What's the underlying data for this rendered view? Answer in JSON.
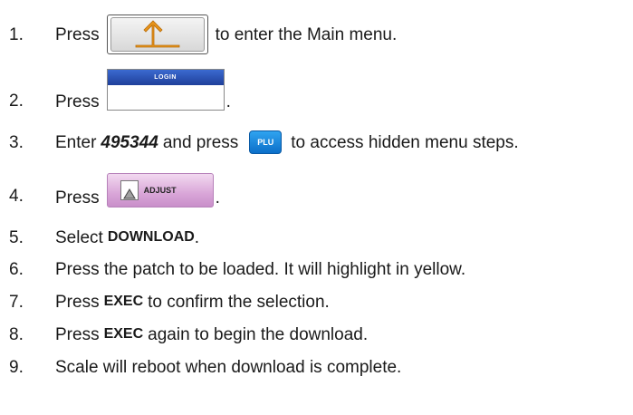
{
  "steps": [
    {
      "num": "1.",
      "pre": "Press",
      "post": "to enter the Main menu."
    },
    {
      "num": "2.",
      "pre": "Press",
      "post": "."
    },
    {
      "num": "3.",
      "pre": "Enter",
      "code": "495344",
      "mid": "and press",
      "post": "to access hidden menu steps."
    },
    {
      "num": "4.",
      "pre": "Press",
      "post": "."
    },
    {
      "num": "5.",
      "pre": "Select",
      "bold": "DOWNLOAD",
      "post": "."
    },
    {
      "num": "6.",
      "text": "Press the patch to be loaded. It will highlight in yellow."
    },
    {
      "num": "7.",
      "pre": "Press",
      "bold": "EXEC",
      "post": "to confirm the selection."
    },
    {
      "num": "8.",
      "pre": "Press",
      "bold": "EXEC",
      "post": "again to begin the download."
    },
    {
      "num": "9.",
      "text": "Scale will reboot when download is complete."
    }
  ],
  "buttons": {
    "login_label": "LOGIN",
    "plu_label": "PLU",
    "adjust_label": "ADJUST",
    "back_icon": "back-arrow-icon",
    "back_color": "#e8941a",
    "login_bar_color": "#2a4fb8",
    "plu_color": "#1a86dd",
    "adjust_color": "#d9a6d8"
  }
}
